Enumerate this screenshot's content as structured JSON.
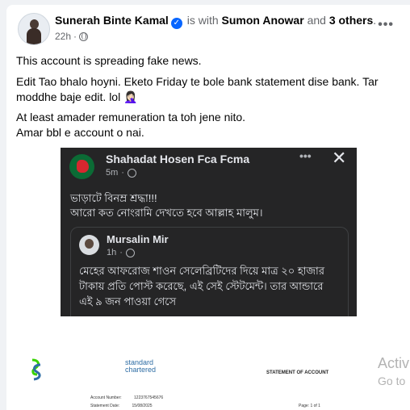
{
  "post": {
    "author": "Sunerah Binte Kamal",
    "is_with": "is with",
    "tag1": "Sumon Anowar",
    "and_word": "and",
    "others": "3 others",
    "period": ".",
    "time": "22h",
    "sep": "·",
    "more": "•••",
    "lines": [
      "This account is spreading fake news.",
      "Edit Tao bhalo hoyni. Eketo Friday te bole bank statement dise bank. Tar",
      "moddhe baje edit. lol 🤦🏻‍♀️",
      "At least amader remuneration ta toh jene nito.",
      "Amar bbl e account o nai."
    ]
  },
  "screenshot": {
    "author": "Shahadat Hosen Fca Fcma",
    "time": "5m",
    "sep": "·",
    "dots": "•••",
    "close": "✕",
    "lines": [
      "ভাড়াটে বিনম্র শ্রদ্ধা!!!",
      "আরো কত নোংরামি দেখতে হবে আল্লাহ মালুম।"
    ],
    "shared": {
      "author": "Mursalin Mir",
      "time": "1h",
      "sep": "·",
      "lines": [
        "মেহের আফরোজ শাওন সেলেব্রিটিদের দিয়ে মাত্র ২০ হাজার",
        "টাকায় প্রতি পোস্ট করেছে, এই সেই স্টেটমেন্ট। তার আন্ডারে",
        "এই ৯ জন পাওয়া গেসে"
      ]
    }
  },
  "document": {
    "bank_line1": "standard",
    "bank_line2": "chartered",
    "title": "STATEMENT OF ACCOUNT",
    "account_label": "Account Number:",
    "account_value": "1223767545676",
    "date_label": "Statement Date:",
    "date_value": "15/08/2025",
    "page": "Page: 1 of 1"
  },
  "overlay": {
    "activate": "Activ",
    "goto": "Go to"
  },
  "colors": {
    "accent": "#0866ff",
    "dark_bg": "#252526",
    "bank_blue": "#2e6da4",
    "bank_green": "#38d200"
  }
}
